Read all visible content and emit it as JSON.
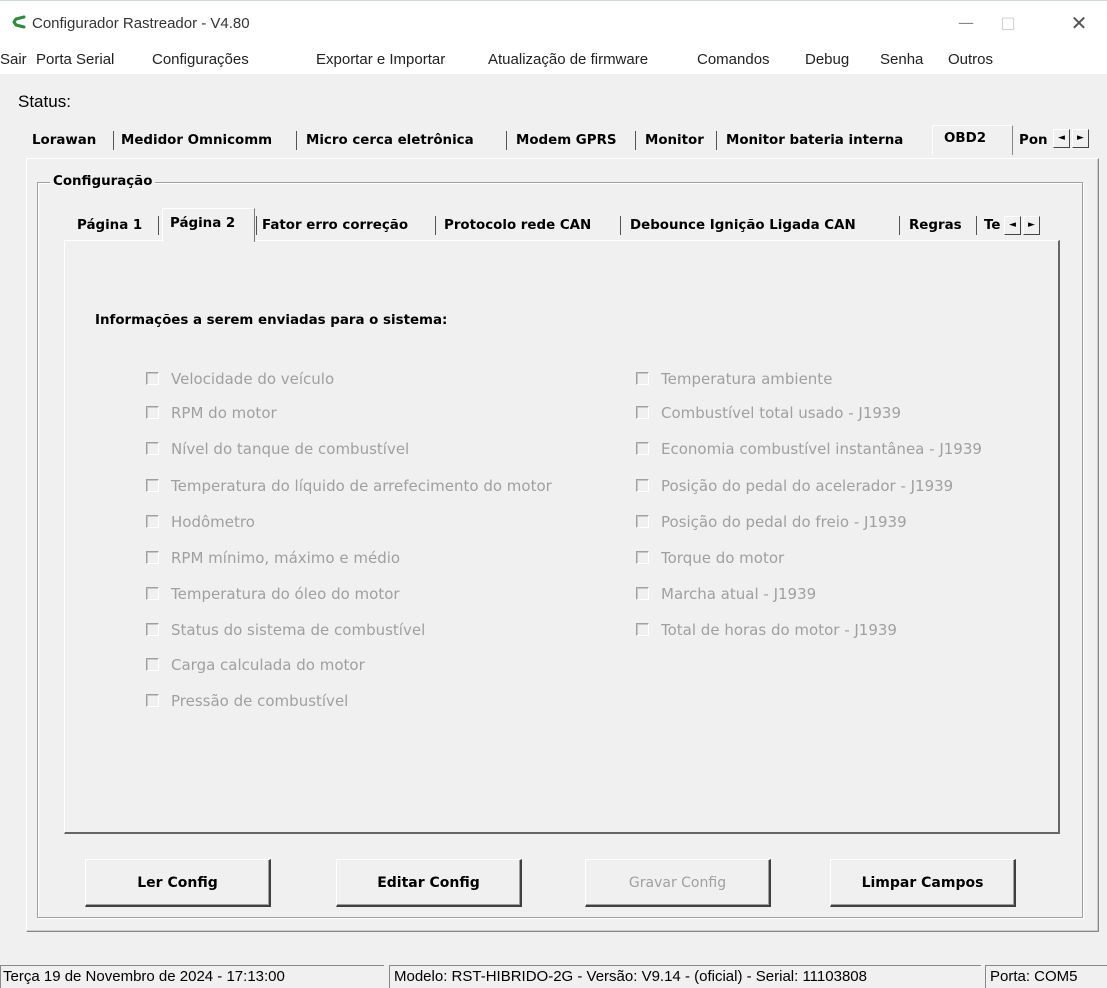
{
  "window": {
    "title": "Configurador Rastreador - V4.80",
    "minimize_glyph": "—",
    "maximize_glyph": "□",
    "close_glyph": "✕",
    "icon": "app-logo-icon",
    "accent_color": "#2e8b3a"
  },
  "menu": {
    "items": [
      "Sair",
      "Porta Serial",
      "Configurações",
      "Exportar e Importar",
      "Atualização de firmware",
      "Comandos",
      "Debug",
      "Senha",
      "Outros"
    ]
  },
  "status": {
    "label": "Status:"
  },
  "outer_tabs": {
    "items": [
      "Lorawan",
      "Medidor Omnicomm",
      "Micro cerca eletrônica",
      "Modem GPRS",
      "Monitor",
      "Monitor bateria interna",
      "OBD2",
      "Pon"
    ],
    "selected": "OBD2",
    "scroll_left": "◄",
    "scroll_right": "►"
  },
  "group": {
    "title": "Configuração"
  },
  "inner_tabs": {
    "items": [
      "Página 1",
      "Página 2",
      "Fator erro correção",
      "Protocolo rede CAN",
      "Debounce Ignição Ligada CAN",
      "Regras",
      "Te"
    ],
    "selected": "Página 2",
    "scroll_left": "◄",
    "scroll_right": "►"
  },
  "section": {
    "label": "Informações a serem enviadas para o sistema:"
  },
  "checkboxes_left": [
    {
      "label": "Velocidade do veículo",
      "checked": false,
      "enabled": false
    },
    {
      "label": "RPM do motor",
      "checked": false,
      "enabled": false
    },
    {
      "label": "Nível do tanque de combustível",
      "checked": false,
      "enabled": false
    },
    {
      "label": "Temperatura do líquido de arrefecimento do motor",
      "checked": false,
      "enabled": false
    },
    {
      "label": "Hodômetro",
      "checked": false,
      "enabled": false
    },
    {
      "label": "RPM mínimo, máximo e médio",
      "checked": false,
      "enabled": false
    },
    {
      "label": "Temperatura do óleo do motor",
      "checked": false,
      "enabled": false
    },
    {
      "label": "Status do sistema de combustível",
      "checked": false,
      "enabled": false
    },
    {
      "label": "Carga calculada do motor",
      "checked": false,
      "enabled": false
    },
    {
      "label": "Pressão de combustível",
      "checked": false,
      "enabled": false
    }
  ],
  "checkboxes_right": [
    {
      "label": "Temperatura ambiente",
      "checked": false,
      "enabled": false
    },
    {
      "label": "Combustível total usado - J1939",
      "checked": false,
      "enabled": false
    },
    {
      "label": "Economia combustível instantânea - J1939",
      "checked": false,
      "enabled": false
    },
    {
      "label": "Posição do pedal do acelerador - J1939",
      "checked": false,
      "enabled": false
    },
    {
      "label": "Posição do pedal do freio - J1939",
      "checked": false,
      "enabled": false
    },
    {
      "label": "Torque do motor",
      "checked": false,
      "enabled": false
    },
    {
      "label": "Marcha atual - J1939",
      "checked": false,
      "enabled": false
    },
    {
      "label": "Total de horas do motor - J1939",
      "checked": false,
      "enabled": false
    }
  ],
  "buttons": {
    "read": "Ler Config",
    "edit": "Editar Config",
    "save": "Gravar Config",
    "clear": "Limpar Campos"
  },
  "statusbar": {
    "datetime": "Terça 19 de Novembro de 2024  -  17:13:00",
    "device": "Modelo: RST-HIBRIDO-2G  -  Versão: V9.14 - (oficial)  -  Serial: 11103808",
    "port": "Porta: COM5"
  }
}
